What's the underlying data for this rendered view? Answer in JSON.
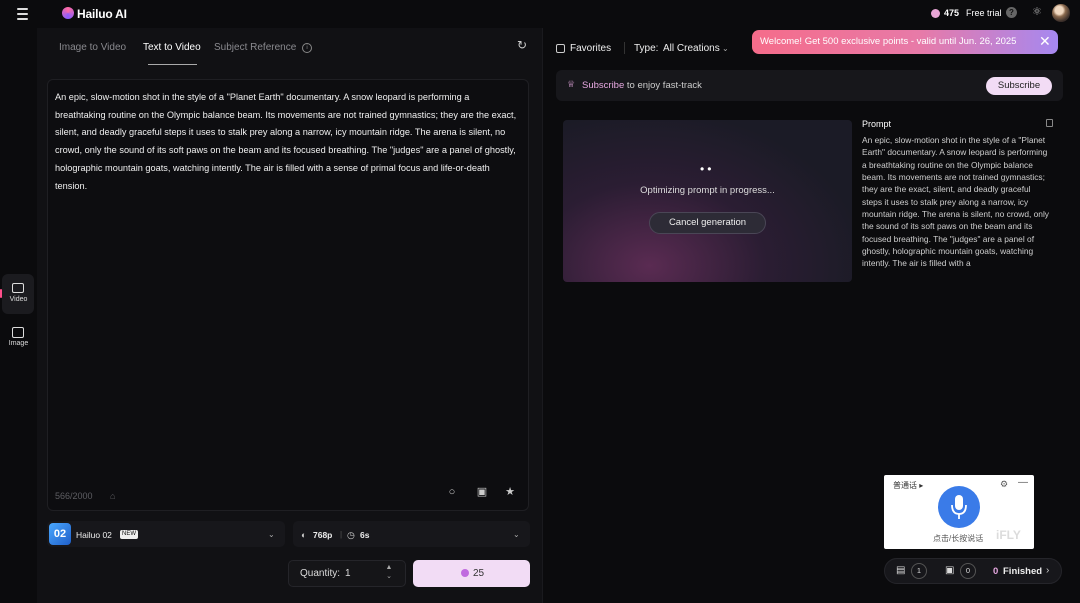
{
  "header": {
    "logo_text": "Hailuo AI",
    "points": "475",
    "trial_label": "Free trial",
    "help_glyph": "?"
  },
  "rail": {
    "items": [
      {
        "label": "Video",
        "icon": "video-icon",
        "active": true
      },
      {
        "label": "Image",
        "icon": "image-icon",
        "active": false
      }
    ]
  },
  "tabs": [
    {
      "label": "Image to Video",
      "active": false
    },
    {
      "label": "Text to Video",
      "active": true
    },
    {
      "label": "Subject Reference",
      "active": false
    }
  ],
  "prompt": {
    "text": "An epic, slow-motion shot in the style of a \"Planet Earth\" documentary. A snow leopard is performing a breathtaking routine on the Olympic balance beam. Its movements are not trained gymnastics; they are the exact, silent, and deadly graceful steps it uses to stalk prey along a narrow, icy mountain ridge. The arena is silent, no crowd, only the sound of its soft paws on the beam and its focused breathing. The \"judges\" are a panel of ghostly, holographic mountain goats, watching intently. The air is filled with a sense of primal focus and life-or-death tension.",
    "char_count": "566/2000"
  },
  "model": {
    "thumb_text": "02",
    "name": "Hailuo 02",
    "badge": "NEW"
  },
  "settings": {
    "resolution": "768p",
    "duration": "6s"
  },
  "quantity": {
    "label": "Quantity:",
    "value": "1"
  },
  "generate": {
    "cost": "25"
  },
  "filters": {
    "favorites_label": "Favorites",
    "type_label": "Type:",
    "type_value": "All Creations"
  },
  "toast": {
    "text": "Welcome! Get 500 exclusive points - valid until Jun. 26, 2025"
  },
  "subscribe_bar": {
    "highlight": "Subscribe",
    "text": " to enjoy fast-track",
    "button": "Subscribe"
  },
  "generation_card": {
    "status": "Optimizing prompt in progress...",
    "cancel_label": "Cancel generation",
    "prompt_title": "Prompt",
    "prompt_text": "An epic, slow-motion shot in the style of a \"Planet Earth\" documentary. A snow leopard is performing a breathtaking routine on the Olympic balance beam. Its movements are not trained gymnastics; they are the exact, silent, and deadly graceful steps it uses to stalk prey along a narrow, icy mountain ridge. The arena is silent, no crowd, only the sound of its soft paws on the beam and its focused breathing. The \"judges\" are a panel of ghostly, holographic mountain goats, watching intently. The air is filled with a"
  },
  "ifly_widget": {
    "language": "普通话",
    "hint": "点击/长按说话",
    "brand": "iFLY"
  },
  "status_bar": {
    "queue_count": "1",
    "image_count": "0",
    "finished_count": "0",
    "finished_label": "Finished"
  },
  "colors": {
    "accent_pink": "#f2dcf5",
    "toast_start": "#f56c8a",
    "toast_end": "#a688f0",
    "indicator": "#ff4f8b"
  }
}
